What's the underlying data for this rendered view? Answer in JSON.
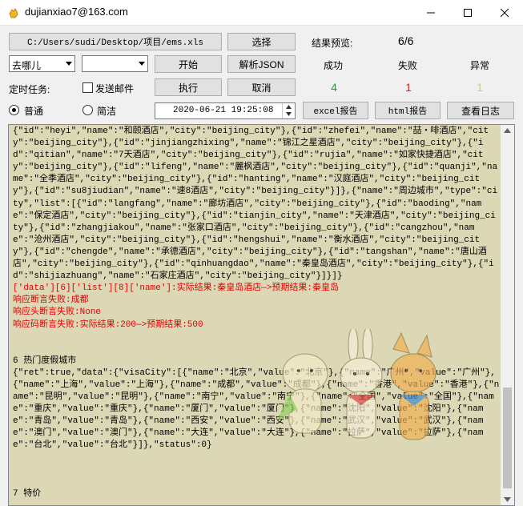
{
  "window": {
    "title": "dujianxiao7@163.com",
    "minimize": "—",
    "maximize": "☐",
    "close": "✕"
  },
  "toolbar": {
    "file_path": "C:/Users/sudi/Desktop/项目/ems.xls",
    "select_label": "选择",
    "result_preview_label": "结果预览:",
    "result_preview_value": "6/6",
    "destination_value": "去哪儿",
    "secondary_select_value": "",
    "start_label": "开始",
    "parse_json_label": "解析JSON",
    "success_label": "成功",
    "fail_label": "失败",
    "error_label": "异常",
    "scheduled_task_label": "定时任务:",
    "send_email_label": "发送邮件",
    "execute_label": "执行",
    "cancel_label": "取消",
    "success_count": "4",
    "fail_count": "1",
    "error_count": "1",
    "mode_normal_label": "普通",
    "mode_simple_label": "简洁",
    "datetime_value": "2020-06-21 19:25:08",
    "excel_report_label": "excel报告",
    "html_report_label": "html报告",
    "view_log_label": "查看日志"
  },
  "colors": {
    "success": "#2e9a2e",
    "fail": "#e02020",
    "error": "#f0c068",
    "log_background": "#dcd7b4",
    "log_error": "#e00000"
  },
  "log": {
    "block1": "{\"id\":\"heyi\",\"name\":\"和颐酒店\",\"city\":\"beijing_city\"},{\"id\":\"zhefei\",\"name\":\"喆・啡酒店\",\"city\":\"beijing_city\"},{\"id\":\"jinjiangzhixing\",\"name\":\"锦江之星酒店\",\"city\":\"beijing_city\"},{\"id\":\"qitian\",\"name\":\"7天酒店\",\"city\":\"beijing_city\"},{\"id\":\"rujia\",\"name\":\"如家快捷酒店\",\"city\":\"beijing_city\"},{\"id\":\"lifeng\",\"name\":\"麗枫酒店\",\"city\":\"beijing_city\"},{\"id\":\"quanji\",\"name\":\"全季酒店\",\"city\":\"beijing_city\"},{\"id\":\"hanting\",\"name\":\"汉庭酒店\",\"city\":\"beijing_city\"},{\"id\":\"su8jiudian\",\"name\":\"速8酒店\",\"city\":\"beijing_city\"}]},{\"name\":\"周边城市\",\"type\":\"city\",\"list\":[{\"id\":\"langfang\",\"name\":\"廊坊酒店\",\"city\":\"beijing_city\"},{\"id\":\"baoding\",\"name\":\"保定酒店\",\"city\":\"beijing_city\"},{\"id\":\"tianjin_city\",\"name\":\"天津酒店\",\"city\":\"beijing_city\"},{\"id\":\"zhangjiakou\",\"name\":\"张家口酒店\",\"city\":\"beijing_city\"},{\"id\":\"cangzhou\",\"name\":\"沧州酒店\",\"city\":\"beijing_city\"},{\"id\":\"hengshui\",\"name\":\"衡水酒店\",\"city\":\"beijing_city\"},{\"id\":\"chengde\",\"name\":\"承德酒店\",\"city\":\"beijing_city\"},{\"id\":\"tangshan\",\"name\":\"唐山酒店\",\"city\":\"beijing_city\"},{\"id\":\"qinhuangdao\",\"name\":\"秦皇岛酒店\",\"city\":\"beijing_city\"},{\"id\":\"shijiazhuang\",\"name\":\"石家庄酒店\",\"city\":\"beijing_city\"}]}]}",
    "error_lines": [
      "['data'][6]['list'][8]['name']:实际结果:秦皇岛酒店—>预期结果:秦皇岛",
      "响应断言失败:成都",
      "响应头断言失败:None",
      "响应码断言失败:实际结果:200—>预期结果:500"
    ],
    "section6_title": "6 热门度假城市",
    "section6_body": "{\"ret\":true,\"data\":{\"visaCity\":[{\"name\":\"北京\",\"value\":\"北京\"},{\"name\":\"广州\",\"value\":\"广州\"},{\"name\":\"上海\",\"value\":\"上海\"},{\"name\":\"成都\",\"value\":\"成都\"},{\"name\":\"香港\",\"value\":\"香港\"},{\"name\":\"昆明\",\"value\":\"昆明\"},{\"name\":\"南宁\",\"value\":\"南宁\"},{\"name\":\"全国\",\"value\":\"全国\"},{\"name\":\"重庆\",\"value\":\"重庆\"},{\"name\":\"厦门\",\"value\":\"厦门\"},{\"name\":\"沈阳\",\"value\":\"沈阳\"},{\"name\":\"青岛\",\"value\":\"青岛\"},{\"name\":\"西安\",\"value\":\"西安\"},{\"name\":\"武汉\",\"value\":\"武汉\"},{\"name\":\"澳门\",\"value\":\"澳门\"},{\"name\":\"大连\",\"value\":\"大连\"},{\"name\":\"拉萨\",\"value\":\"拉萨\"},{\"name\":\"台北\",\"value\":\"台北\"}]},\"status\":0}",
    "section7_title": "7 特价"
  }
}
